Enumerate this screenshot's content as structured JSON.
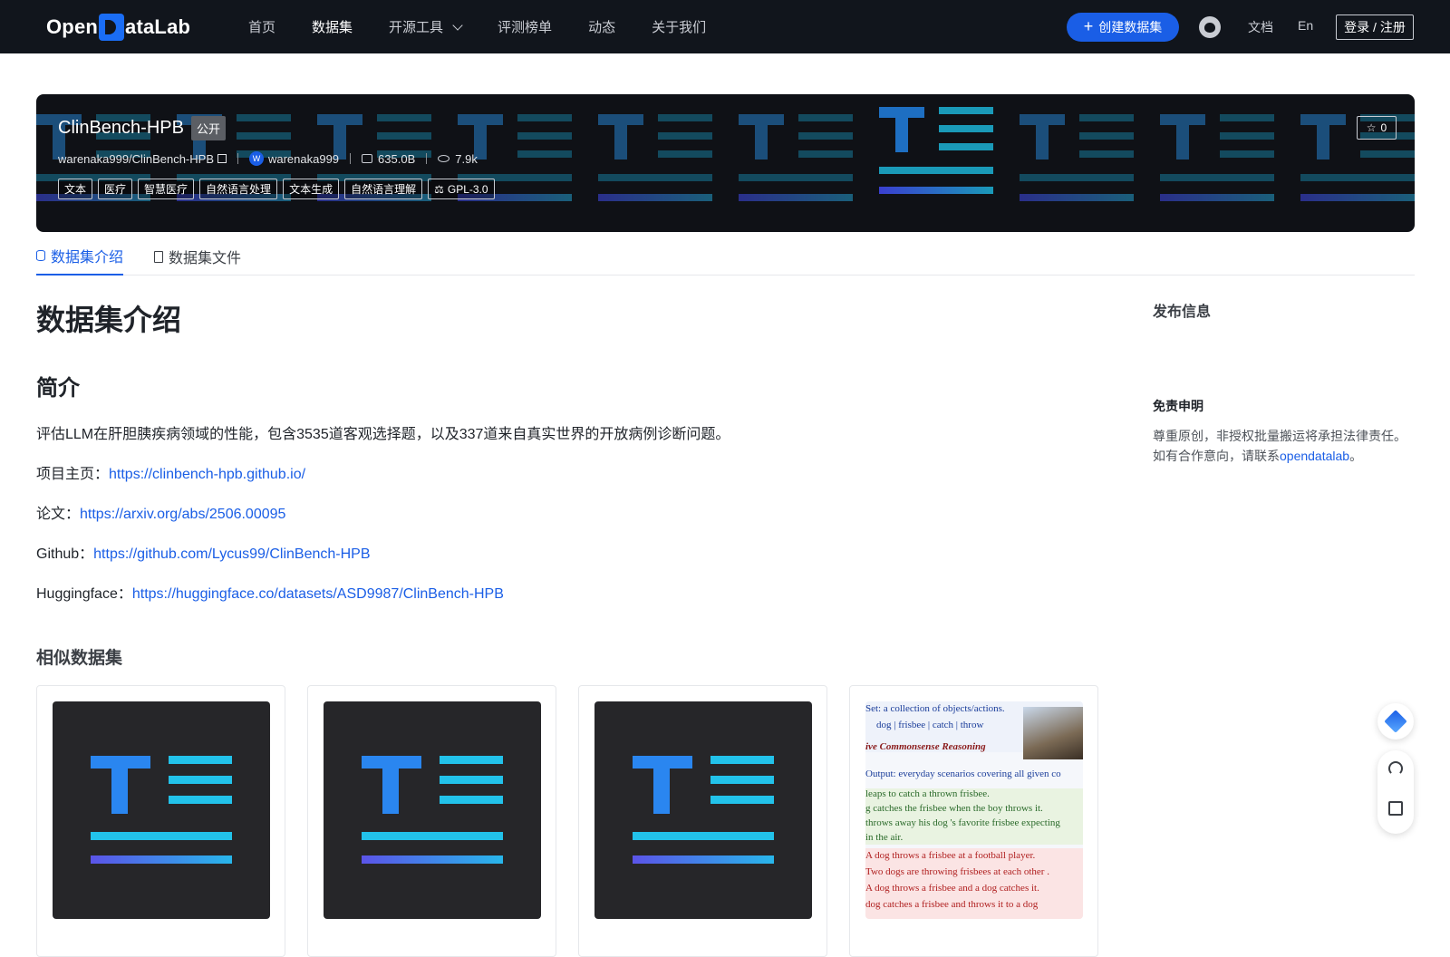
{
  "header": {
    "logo_text": "OpenDataLab",
    "nav": [
      "首页",
      "数据集",
      "开源工具",
      "评测榜单",
      "动态",
      "关于我们"
    ],
    "active_nav": "数据集",
    "create_label": "创建数据集",
    "docs_label": "文档",
    "lang_label": "En",
    "login_label": "登录 / 注册"
  },
  "dataset": {
    "name": "ClinBench-HPB",
    "visibility": "公开",
    "full_id": "warenaka999/ClinBench-HPB",
    "avatar_letter": "W",
    "owner": "warenaka999",
    "size": "635.0B",
    "views": "7.9k",
    "tags": [
      "文本",
      "医疗",
      "智慧医疗",
      "自然语言处理",
      "文本生成",
      "自然语言理解"
    ],
    "license": "GPL-3.0",
    "stars": "0"
  },
  "tabs": [
    "数据集介绍",
    "数据集文件"
  ],
  "content": {
    "title": "数据集介绍",
    "section": "简介",
    "description": "评估LLM在肝胆胰疾病领域的性能，包含3535道客观选择题，以及337道来自真实世界的开放病例诊断问题。",
    "project_label": "项目主页：",
    "project_url": "https://clinbench-hpb.github.io/",
    "paper_label": "论文：",
    "paper_url": "https://arxiv.org/abs/2506.00095",
    "github_label": "Github：",
    "github_url": "https://github.com/Lycus99/ClinBench-HPB",
    "hf_label": "Huggingface：",
    "hf_url": "https://huggingface.co/datasets/ASD9987/ClinBench-HPB",
    "similar_title": "相似数据集"
  },
  "sidebar": {
    "release_title": "发布信息",
    "disclaimer_title": "免责申明",
    "disclaimer_line1": "尊重原创，非授权批量搬运将承担法律责任。",
    "disclaimer_prefix": "如有合作意向，请联系",
    "disclaimer_link": "opendatalab",
    "disclaimer_suffix": "。"
  },
  "similar_card4_lines": [
    "Set: a collection of objects/actions.",
    "dog | frisbee | catch | throw",
    "ive Commonsense Reasoning",
    "Output: everyday scenarios covering all given co",
    "leaps to catch a thrown frisbee.",
    "g catches the frisbee when the boy throws it.",
    "throws away his dog 's favorite frisbee expecting",
    "in the air.",
    "A dog throws a frisbee at a football player.",
    "Two dogs are throwing frisbees at each other .",
    "A dog throws a frisbee and a dog catches it.",
    "dog catches a frisbee and throws it to a dog"
  ],
  "colors": {
    "brand": "#1a5ee6",
    "topbar": "#11151c"
  }
}
